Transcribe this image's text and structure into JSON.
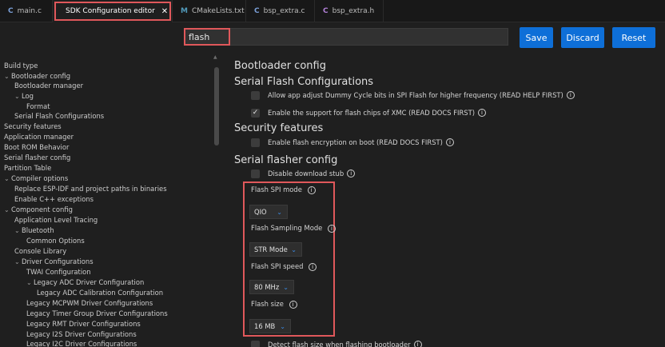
{
  "tabs": [
    {
      "icon": "C",
      "label": "main.c"
    },
    {
      "icon": "●",
      "label": "SDK Configuration editor",
      "close": "✕"
    },
    {
      "icon": "M",
      "label": "CMakeLists.txt"
    },
    {
      "icon": "C",
      "label": "bsp_extra.c"
    },
    {
      "icon": "C",
      "label": "bsp_extra.h"
    }
  ],
  "toolbar": {
    "search_value": "flash",
    "save_label": "Save",
    "discard_label": "Discard",
    "reset_label": "Reset"
  },
  "tree": [
    {
      "label": "Build type",
      "chevron": ""
    },
    {
      "label": "Bootloader config",
      "chevron": "⌄"
    },
    {
      "label": "Bootloader manager",
      "chevron": ""
    },
    {
      "label": "Log",
      "chevron": "⌄"
    },
    {
      "label": "Format",
      "chevron": ""
    },
    {
      "label": "Serial Flash Configurations",
      "chevron": ""
    },
    {
      "label": "Security features",
      "chevron": ""
    },
    {
      "label": "Application manager",
      "chevron": ""
    },
    {
      "label": "Boot ROM Behavior",
      "chevron": ""
    },
    {
      "label": "Serial flasher config",
      "chevron": ""
    },
    {
      "label": "Partition Table",
      "chevron": ""
    },
    {
      "label": "Compiler options",
      "chevron": "⌄"
    },
    {
      "label": "Replace ESP-IDF and project paths in binaries",
      "chevron": ""
    },
    {
      "label": "Enable C++ exceptions",
      "chevron": ""
    },
    {
      "label": "Component config",
      "chevron": "⌄"
    },
    {
      "label": "Application Level Tracing",
      "chevron": ""
    },
    {
      "label": "Bluetooth",
      "chevron": "⌄"
    },
    {
      "label": "Common Options",
      "chevron": ""
    },
    {
      "label": "Console Library",
      "chevron": ""
    },
    {
      "label": "Driver Configurations",
      "chevron": "⌄"
    },
    {
      "label": "TWAI Configuration",
      "chevron": ""
    },
    {
      "label": "Legacy ADC Driver Configuration",
      "chevron": "⌄"
    },
    {
      "label": "Legacy ADC Calibration Configuration",
      "chevron": ""
    },
    {
      "label": "Legacy MCPWM Driver Configurations",
      "chevron": ""
    },
    {
      "label": "Legacy Timer Group Driver Configurations",
      "chevron": ""
    },
    {
      "label": "Legacy RMT Driver Configurations",
      "chevron": ""
    },
    {
      "label": "Legacy I2S Driver Configurations",
      "chevron": ""
    },
    {
      "label": "Legacy I2C Driver Configurations",
      "chevron": ""
    }
  ],
  "main": {
    "bootloader_heading": "Bootloader config",
    "serial_flash_heading": "Serial Flash Configurations",
    "opt_dummy_cycle": "Allow app adjust Dummy Cycle bits in SPI Flash for higher frequency (READ HELP FIRST)",
    "opt_xmc": "Enable the support for flash chips of XMC (READ DOCS FIRST)",
    "security_heading": "Security features",
    "opt_flash_encryption": "Enable flash encryption on boot (READ DOCS FIRST)",
    "serial_flasher_heading": "Serial flasher config",
    "opt_disable_stub": "Disable download stub",
    "spi_mode_label": "Flash SPI mode",
    "spi_mode_value": "QIO",
    "sampling_label": "Flash Sampling Mode",
    "sampling_value": "STR Mode",
    "spi_speed_label": "Flash SPI speed",
    "spi_speed_value": "80 MHz",
    "flash_size_label": "Flash size",
    "flash_size_value": "16 MB",
    "opt_detect_size": "Detect flash size when flashing bootloader",
    "info_glyph": "i",
    "check_glyph": "✓"
  },
  "colors": {
    "accent": "#0e6fd8",
    "highlight": "#e0585b",
    "background": "#1f1f1f"
  }
}
